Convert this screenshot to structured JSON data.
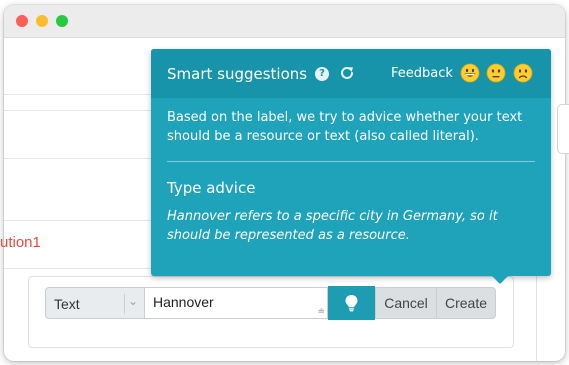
{
  "form": {
    "section_title": "ution1",
    "type_select": {
      "value": "Text"
    },
    "label_input": {
      "value": "Hannover"
    },
    "cancel_label": "Cancel",
    "create_label": "Create"
  },
  "popover": {
    "title": "Smart suggestions",
    "help_icon_glyph": "?",
    "feedback_label": "Feedback",
    "feedback_options": [
      "grinning-face-icon",
      "neutral-face-icon",
      "slightly-frowning-face-icon"
    ],
    "description": "Based on the label, we try to advice whether your text should be a resource or text (also called literal).",
    "advice_title": "Type advice",
    "advice_text": "Hannover refers to a specific city in Germany, so it should be represented as a resource."
  },
  "colors": {
    "popover_bg": "#1fa3bb",
    "popover_header_bg": "#1894aa",
    "section_title": "#e84c3d",
    "button_grey": "#dcdfe2"
  }
}
